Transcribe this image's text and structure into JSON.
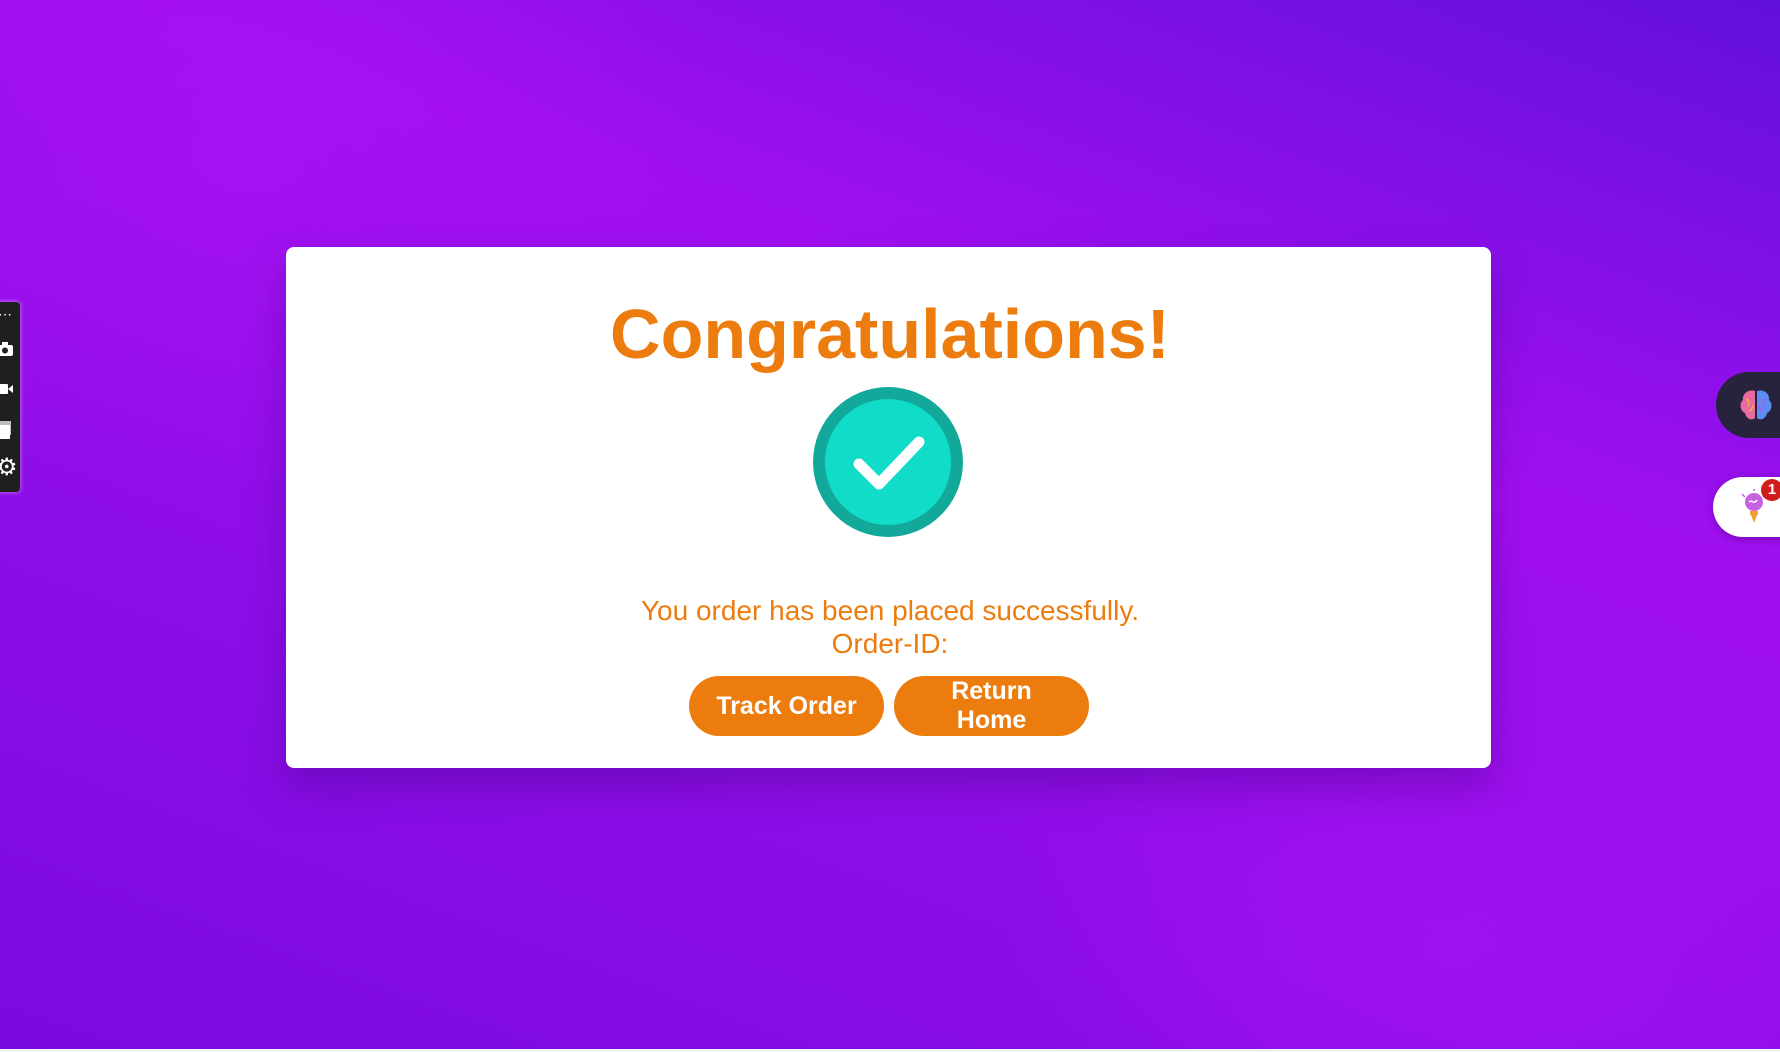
{
  "page": {
    "title": "Congratulations!",
    "message_line1": "You order has been placed successfully.",
    "message_line2": "Order-ID:"
  },
  "actions": {
    "track_order_label": "Track Order",
    "return_home_label": "Return Home"
  },
  "left_toolbar": {
    "items": [
      "more-icon",
      "camera-icon",
      "video-icon",
      "copy-icon",
      "settings-icon"
    ]
  },
  "right_widgets": {
    "brain_icon": "brain-icon",
    "idea_icon": "lightbulb-brain-icon",
    "notification_count": "1"
  },
  "colors": {
    "accent_orange": "#ec7c0e",
    "success_teal": "#10dcc8",
    "success_ring": "#12a99a",
    "background_purple": "#a10ff0",
    "card_background": "#ffffff"
  }
}
